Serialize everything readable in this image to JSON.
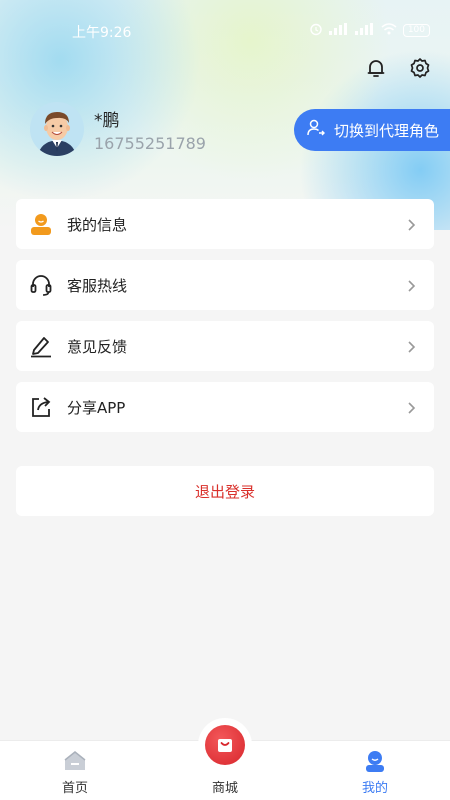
{
  "status_bar": {
    "time": "上午9:26",
    "battery": "100"
  },
  "header": {
    "bell_icon": "bell-icon",
    "settings_icon": "gear-icon"
  },
  "profile": {
    "name": "*鹏",
    "phone": "16755251789"
  },
  "switch_role": {
    "label": "切换到代理角色"
  },
  "menu": [
    {
      "label": "我的信息",
      "icon": "user-info-icon"
    },
    {
      "label": "客服热线",
      "icon": "headset-icon"
    },
    {
      "label": "意见反馈",
      "icon": "pen-icon"
    },
    {
      "label": "分享APP",
      "icon": "share-icon"
    }
  ],
  "logout": {
    "label": "退出登录"
  },
  "tabbar": {
    "home": "首页",
    "mall": "商城",
    "mine": "我的"
  },
  "colors": {
    "accent": "#3d7cf3",
    "danger": "#d9302b",
    "user_icon": "#f29a1d"
  }
}
